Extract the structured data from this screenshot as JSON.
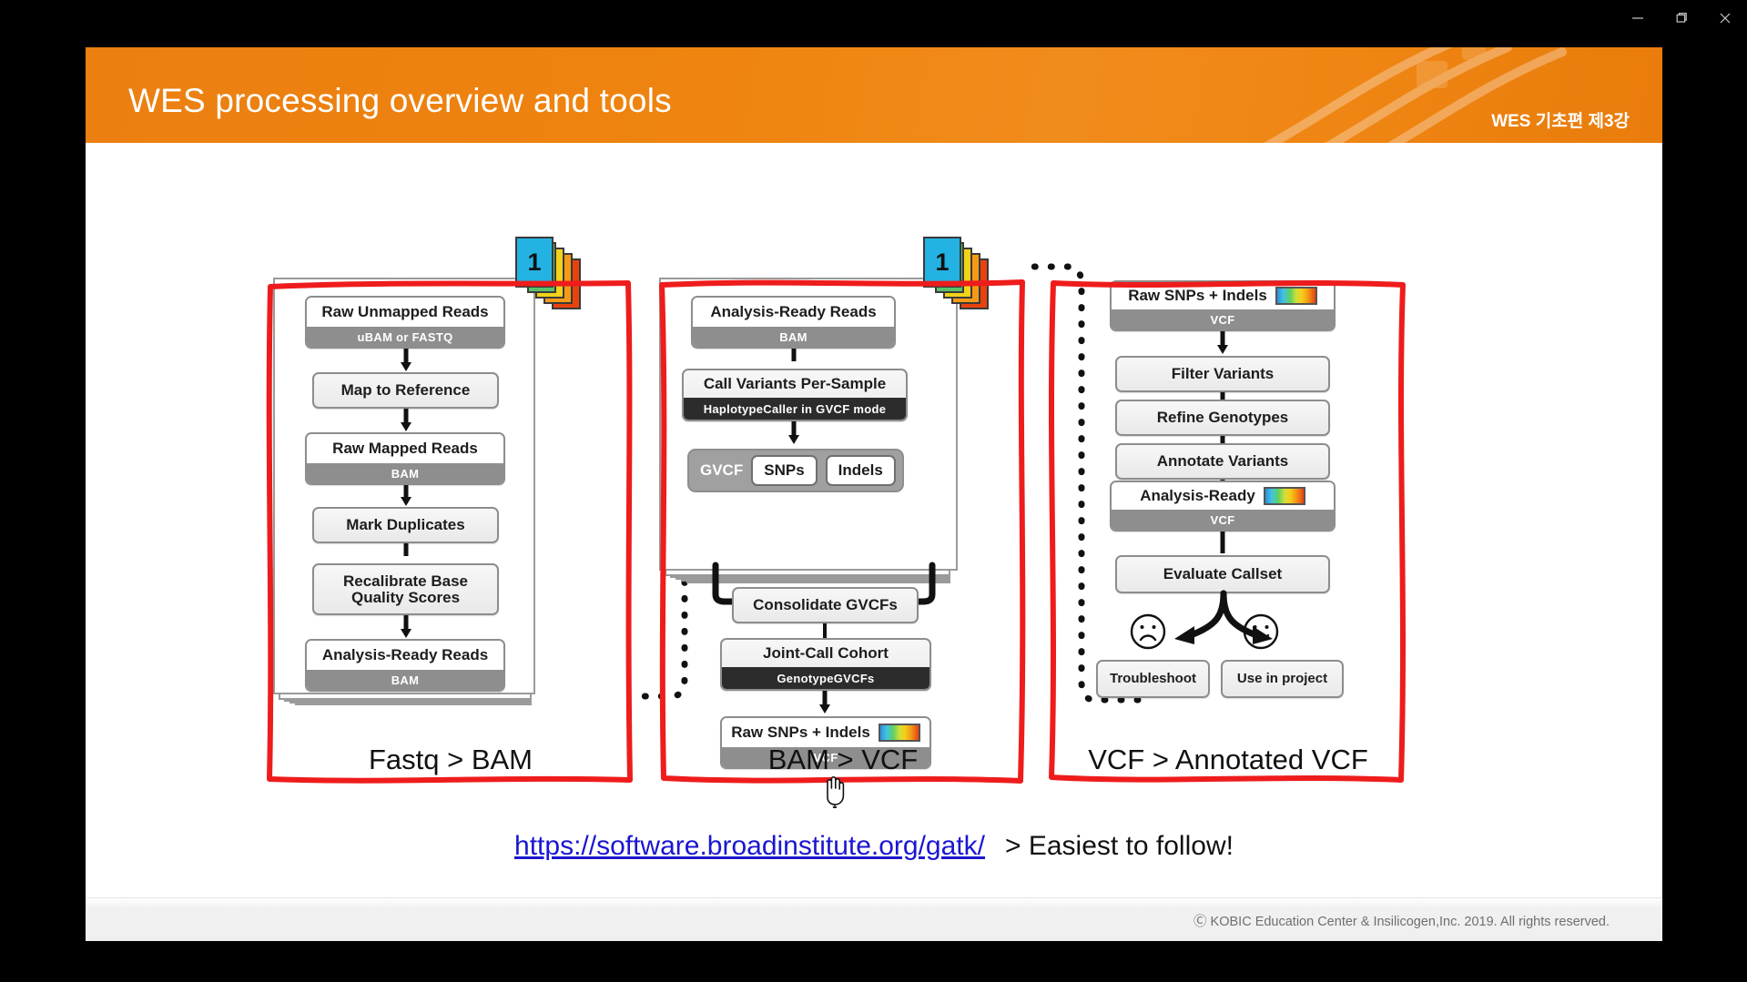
{
  "window": {
    "minimize_label": "Minimize",
    "maximize_label": "Restore",
    "close_label": "Close"
  },
  "header": {
    "title": "WES processing overview and tools",
    "deck_label": "WES 기초편 제3강",
    "background_color": "#ef8410"
  },
  "footer": {
    "copyright": "Ⓒ KOBIC Education Center & Insilicogen,Inc. 2019. All rights reserved."
  },
  "link": {
    "url_text": "https://software.broadinstitute.org/gatk/",
    "note": "> Easiest to follow!",
    "color": "#1a16d0"
  },
  "annotation": {
    "color": "#ee1c1c"
  },
  "panels": [
    {
      "id": "panel-1",
      "caption": "Fastq > BAM",
      "tab_number": "1",
      "steps": [
        {
          "title": "Raw Unmapped Reads",
          "sub": "uBAM or FASTQ",
          "sub_style": "gray",
          "style": "white"
        },
        {
          "title": "Map to Reference",
          "sub": "",
          "sub_style": "",
          "style": "plain"
        },
        {
          "title": "Raw Mapped Reads",
          "sub": "BAM",
          "sub_style": "gray",
          "style": "white"
        },
        {
          "title": "Mark Duplicates",
          "sub": "",
          "sub_style": "",
          "style": "plain"
        },
        {
          "title": "Recalibrate Base\nQuality Scores",
          "sub": "",
          "sub_style": "",
          "style": "plain"
        },
        {
          "title": "Analysis-Ready Reads",
          "sub": "BAM",
          "sub_style": "gray",
          "style": "white"
        }
      ]
    },
    {
      "id": "panel-2",
      "caption": "BAM > VCF",
      "tab_number": "1",
      "steps": [
        {
          "title": "Analysis-Ready Reads",
          "sub": "BAM",
          "sub_style": "gray",
          "style": "white"
        },
        {
          "title": "Call Variants Per-Sample",
          "sub": "HaplotypeCaller in GVCF mode",
          "sub_style": "dark",
          "style": "plain"
        }
      ],
      "chip_group": {
        "label": "GVCF",
        "chips": [
          "SNPs",
          "Indels"
        ]
      },
      "steps_after": [
        {
          "title": "Consolidate GVCFs",
          "sub": "",
          "sub_style": "",
          "style": "plain"
        },
        {
          "title": "Joint-Call Cohort",
          "sub": "GenotypeGVCFs",
          "sub_style": "dark",
          "style": "plain"
        },
        {
          "title": "Raw SNPs + Indels",
          "sub": "VCF",
          "sub_style": "gray",
          "style": "white",
          "swatch": true
        }
      ]
    },
    {
      "id": "panel-3",
      "caption": "VCF > Annotated VCF",
      "steps": [
        {
          "title": "Raw SNPs + Indels",
          "sub": "VCF",
          "sub_style": "gray",
          "style": "white",
          "swatch": true
        },
        {
          "title": "Filter Variants",
          "sub": "",
          "sub_style": "",
          "style": "plain"
        },
        {
          "title": "Refine Genotypes",
          "sub": "",
          "sub_style": "",
          "style": "plain"
        },
        {
          "title": "Annotate Variants",
          "sub": "",
          "sub_style": "",
          "style": "plain"
        },
        {
          "title": "Analysis-Ready",
          "sub": "VCF",
          "sub_style": "gray",
          "style": "white",
          "swatch": true
        },
        {
          "title": "Evaluate Callset",
          "sub": "",
          "sub_style": "",
          "style": "plain"
        }
      ],
      "outcomes": [
        {
          "face": "sad-face-icon",
          "label": "Troubleshoot"
        },
        {
          "face": "happy-face-icon",
          "label": "Use in project"
        }
      ]
    }
  ]
}
